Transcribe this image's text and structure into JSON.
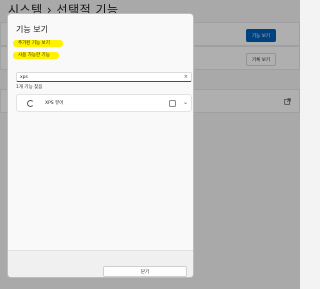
{
  "background": {
    "breadcrumb": "시스템 › 선택적 기능",
    "primary_button": "기능 보기",
    "secondary_button": "기록 보기",
    "external_icon": "external-link-icon"
  },
  "dialog": {
    "title": "기능 보기",
    "highlight_one": "추가된 기능 보기",
    "highlight_two": "사용 가능한 기능",
    "search_value": "xps",
    "search_placeholder": "",
    "clear_glyph": "×",
    "found_text": "1개 기능 찾음",
    "feature": {
      "name": "XPS 뷰어",
      "icon": "feature-gear-icon",
      "checked": false,
      "chevron": "⌄"
    },
    "close_button": "닫기"
  },
  "colors": {
    "accent": "#005fb8",
    "highlight": "#fff200"
  }
}
